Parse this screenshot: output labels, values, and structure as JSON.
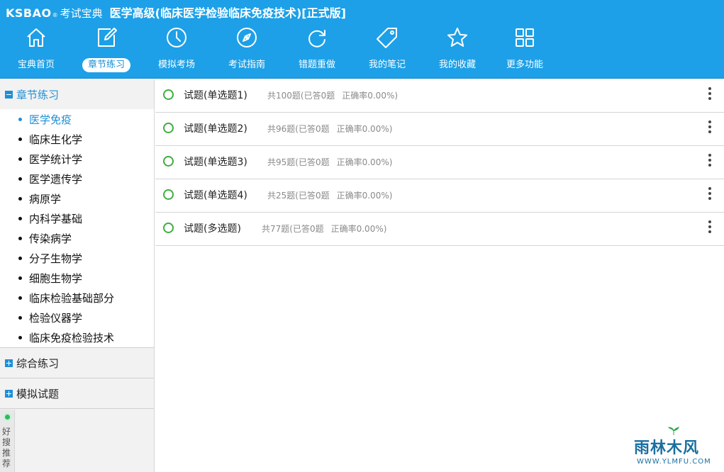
{
  "header": {
    "brand": "KSBAO",
    "brand_reg": "®",
    "product": "考试宝典",
    "title": "医学高级(临床医学检验临床免疫技术)[正式版]",
    "nav": [
      {
        "label": "宝典首页",
        "icon": "home-icon"
      },
      {
        "label": "章节练习",
        "icon": "edit-icon",
        "active": true
      },
      {
        "label": "模拟考场",
        "icon": "clock-icon"
      },
      {
        "label": "考试指南",
        "icon": "compass-icon"
      },
      {
        "label": "错题重做",
        "icon": "refresh-icon"
      },
      {
        "label": "我的笔记",
        "icon": "tag-icon"
      },
      {
        "label": "我的收藏",
        "icon": "star-icon"
      },
      {
        "label": "更多功能",
        "icon": "grid-icon"
      }
    ]
  },
  "sidebar": {
    "sections": [
      {
        "label": "章节练习",
        "expanded": true
      },
      {
        "label": "综合练习",
        "expanded": false
      },
      {
        "label": "模拟试题",
        "expanded": false
      }
    ],
    "chapters": [
      "医学免疫",
      "临床生化学",
      "医学统计学",
      "医学遗传学",
      "病原学",
      "内科学基础",
      "传染病学",
      "分子生物学",
      "细胞生物学",
      "临床检验基础部分",
      "检验仪器学",
      "临床免疫检验技术"
    ],
    "active_chapter": 0,
    "good_search": "好搜推荐"
  },
  "main": {
    "questions": [
      {
        "title": "试题(单选题1)",
        "total": "共100题",
        "answered": "(已答0题",
        "accuracy": "正确率0.00%)"
      },
      {
        "title": "试题(单选题2)",
        "total": "共96题",
        "answered": "(已答0题",
        "accuracy": "正确率0.00%)"
      },
      {
        "title": "试题(单选题3)",
        "total": "共95题",
        "answered": "(已答0题",
        "accuracy": "正确率0.00%)"
      },
      {
        "title": "试题(单选题4)",
        "total": "共25题",
        "answered": "(已答0题",
        "accuracy": "正确率0.00%)"
      },
      {
        "title": "试题(多选题)",
        "total": "共77题",
        "answered": "(已答0题",
        "accuracy": "正确率0.00%)"
      }
    ]
  },
  "watermark": {
    "text": "雨林木风",
    "url": "WWW.YLMFU.COM"
  },
  "colors": {
    "header_bg": "#1da0e7",
    "accent": "#1e8fd6",
    "status_circle": "#3fae3f"
  }
}
